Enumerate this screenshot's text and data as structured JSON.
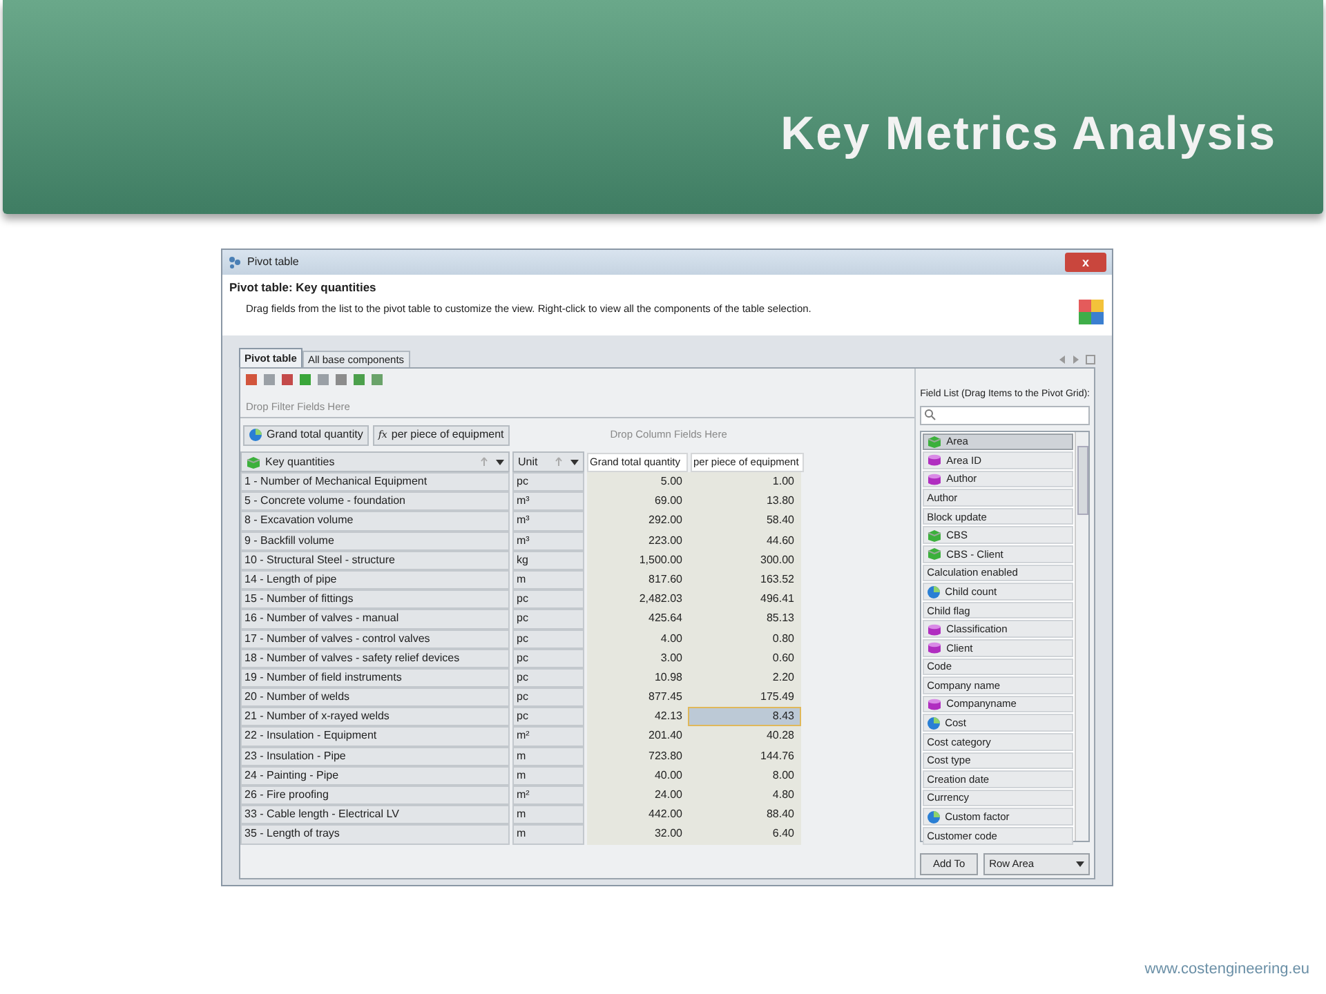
{
  "slide": {
    "title": "Key Metrics Analysis",
    "footer": "www.costengineering.eu"
  },
  "window": {
    "title": "Pivot table",
    "close": "x",
    "heading": "Pivot table: Key quantities",
    "description": "Drag fields from the list to the pivot table to customize the view. Right-click to view all the components of the table selection."
  },
  "tabs": [
    {
      "label": "Pivot table",
      "selected": true
    },
    {
      "label": "All base components",
      "selected": false
    }
  ],
  "filter_area": {
    "placeholder": "Drop Filter Fields Here"
  },
  "data_fields": [
    {
      "label": "Grand total quantity",
      "kind": "measure"
    },
    {
      "label": "per piece of equipment",
      "kind": "formula",
      "prefix": "fx"
    }
  ],
  "column_area": {
    "placeholder": "Drop Column Fields Here"
  },
  "row_headers": [
    {
      "label": "Key quantities",
      "kind": "group"
    },
    {
      "label": "Unit",
      "kind": "plain"
    }
  ],
  "value_headers": [
    "Grand total quantity",
    "per piece of equipment"
  ],
  "rows": [
    {
      "name": "1 - Number of Mechanical Equipment",
      "unit": "pc",
      "total": "5.00",
      "per_piece": "1.00",
      "selected": false
    },
    {
      "name": "5 - Concrete volume - foundation",
      "unit": "m³",
      "total": "69.00",
      "per_piece": "13.80",
      "selected": false
    },
    {
      "name": "8 - Excavation volume",
      "unit": "m³",
      "total": "292.00",
      "per_piece": "58.40",
      "selected": false
    },
    {
      "name": "9 - Backfill volume",
      "unit": "m³",
      "total": "223.00",
      "per_piece": "44.60",
      "selected": false
    },
    {
      "name": "10 - Structural Steel - structure",
      "unit": "kg",
      "total": "1,500.00",
      "per_piece": "300.00",
      "selected": false
    },
    {
      "name": "14 - Length of pipe",
      "unit": "m",
      "total": "817.60",
      "per_piece": "163.52",
      "selected": false
    },
    {
      "name": "15 - Number of fittings",
      "unit": "pc",
      "total": "2,482.03",
      "per_piece": "496.41",
      "selected": false
    },
    {
      "name": "16 - Number of valves - manual",
      "unit": "pc",
      "total": "425.64",
      "per_piece": "85.13",
      "selected": false
    },
    {
      "name": "17 - Number of valves - control valves",
      "unit": "pc",
      "total": "4.00",
      "per_piece": "0.80",
      "selected": false
    },
    {
      "name": "18 - Number of valves - safety relief devices",
      "unit": "pc",
      "total": "3.00",
      "per_piece": "0.60",
      "selected": false
    },
    {
      "name": "19 - Number of field instruments",
      "unit": "pc",
      "total": "10.98",
      "per_piece": "2.20",
      "selected": false
    },
    {
      "name": "20 - Number of welds",
      "unit": "pc",
      "total": "877.45",
      "per_piece": "175.49",
      "selected": false
    },
    {
      "name": "21 - Number of x-rayed welds",
      "unit": "pc",
      "total": "42.13",
      "per_piece": "8.43",
      "selected": true
    },
    {
      "name": "22 - Insulation - Equipment",
      "unit": "m²",
      "total": "201.40",
      "per_piece": "40.28",
      "selected": false
    },
    {
      "name": "23 - Insulation - Pipe",
      "unit": "m",
      "total": "723.80",
      "per_piece": "144.76",
      "selected": false
    },
    {
      "name": "24 - Painting - Pipe",
      "unit": "m",
      "total": "40.00",
      "per_piece": "8.00",
      "selected": false
    },
    {
      "name": "26 - Fire proofing",
      "unit": "m²",
      "total": "24.00",
      "per_piece": "4.80",
      "selected": false
    },
    {
      "name": "33 - Cable length - Electrical LV",
      "unit": "m",
      "total": "442.00",
      "per_piece": "88.40",
      "selected": false
    },
    {
      "name": "35 - Length of trays",
      "unit": "m",
      "total": "32.00",
      "per_piece": "6.40",
      "selected": false
    }
  ],
  "field_list": {
    "title": "Field List (Drag Items to the Pivot Grid):",
    "items": [
      {
        "label": "Area",
        "kind": "group",
        "selected": true
      },
      {
        "label": "Area ID",
        "kind": "attribute",
        "selected": false
      },
      {
        "label": "Author",
        "kind": "attribute",
        "selected": false
      },
      {
        "label": "Author",
        "kind": "plain",
        "selected": false
      },
      {
        "label": "Block update",
        "kind": "plain",
        "selected": false
      },
      {
        "label": "CBS",
        "kind": "group",
        "selected": false
      },
      {
        "label": "CBS - Client",
        "kind": "group",
        "selected": false
      },
      {
        "label": "Calculation enabled",
        "kind": "plain",
        "selected": false
      },
      {
        "label": "Child count",
        "kind": "measure",
        "selected": false
      },
      {
        "label": "Child flag",
        "kind": "plain",
        "selected": false
      },
      {
        "label": "Classification",
        "kind": "attribute",
        "selected": false
      },
      {
        "label": "Client",
        "kind": "attribute",
        "selected": false
      },
      {
        "label": "Code",
        "kind": "plain",
        "selected": false
      },
      {
        "label": "Company name",
        "kind": "plain",
        "selected": false
      },
      {
        "label": "Companyname",
        "kind": "attribute",
        "selected": false
      },
      {
        "label": "Cost",
        "kind": "measure",
        "selected": false
      },
      {
        "label": "Cost category",
        "kind": "plain",
        "selected": false
      },
      {
        "label": "Cost type",
        "kind": "plain",
        "selected": false
      },
      {
        "label": "Creation date",
        "kind": "plain",
        "selected": false
      },
      {
        "label": "Currency",
        "kind": "plain",
        "selected": false
      },
      {
        "label": "Custom factor",
        "kind": "measure",
        "selected": false
      },
      {
        "label": "Customer code",
        "kind": "plain",
        "selected": false
      }
    ],
    "add_button": "Add To",
    "target": "Row Area"
  }
}
